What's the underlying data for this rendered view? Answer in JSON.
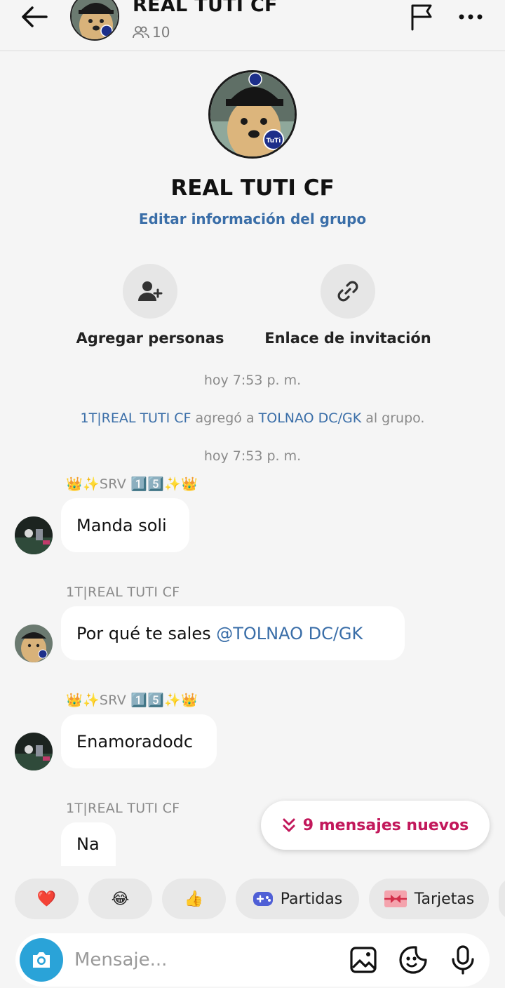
{
  "header": {
    "title": "REAL TUTI CF",
    "member_count": "10"
  },
  "group": {
    "name": "REAL TUTI CF",
    "edit_link": "Editar información del grupo",
    "actions": [
      {
        "label": "Agregar personas"
      },
      {
        "label": "Enlace de invitación"
      }
    ]
  },
  "timeline": {
    "timestamp_1": "hoy 7:53 p. m.",
    "system_actor": "1T|REAL TUTI CF",
    "system_verb": " agregó a ",
    "system_target": "TOLNAO DC/GK",
    "system_tail": " al grupo.",
    "timestamp_2": "hoy 7:53 p. m."
  },
  "messages": [
    {
      "sender": "👑✨SRV 1️⃣5️⃣✨👑",
      "text": "Manda soli"
    },
    {
      "sender": "1T|REAL TUTI CF",
      "text": "Por qué te sales ",
      "mention": "@TOLNAO DC/GK"
    },
    {
      "sender": "👑✨SRV 1️⃣5️⃣✨👑",
      "text": "Enamoradodc"
    },
    {
      "sender": "1T|REAL TUTI CF",
      "text": "Na"
    }
  ],
  "new_messages": {
    "label": "9 mensajes nuevos",
    "color": "#c2185b"
  },
  "quick_reactions": [
    {
      "emoji": "❤️"
    },
    {
      "emoji": "😂"
    },
    {
      "emoji": "👍"
    },
    {
      "emoji": "🎮",
      "label": "Partidas"
    },
    {
      "emoji": "🎀",
      "label": "Tarjetas"
    }
  ],
  "composer": {
    "placeholder": "Mensaje...",
    "accent": "#2aa3d8"
  }
}
